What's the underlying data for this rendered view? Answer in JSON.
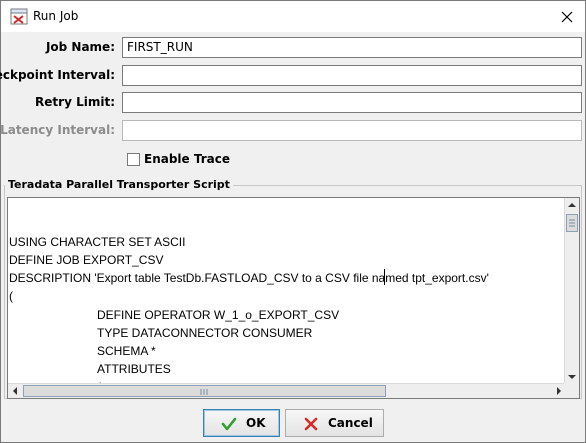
{
  "window": {
    "title": "Run Job",
    "icons": {
      "app": "run-job-icon",
      "close": "close-icon"
    }
  },
  "form": {
    "job_name": {
      "label": "Job Name:",
      "value": "FIRST_RUN"
    },
    "checkpoint_interval": {
      "label": "Checkpoint Interval:",
      "value": ""
    },
    "retry_limit": {
      "label": "Retry Limit:",
      "value": ""
    },
    "latency_interval": {
      "label": "Latency Interval:",
      "value": "",
      "disabled": true
    },
    "enable_trace": {
      "label": "Enable Trace",
      "checked": false
    }
  },
  "script_panel": {
    "title": "Teradata Parallel Transporter Script",
    "lines": [
      "",
      "USING CHARACTER SET ASCII",
      "DEFINE JOB EXPORT_CSV",
      "DESCRIPTION 'Export table TestDb.FASTLOAD_CSV to a CSV file named tpt_export.csv'",
      "(",
      "DEFINE OPERATOR W_1_o_EXPORT_CSV",
      "TYPE DATACONNECTOR CONSUMER",
      "SCHEMA *",
      "ATTRIBUTES",
      "("
    ]
  },
  "buttons": {
    "ok": {
      "label": "OK",
      "icon": "checkmark-icon"
    },
    "cancel": {
      "label": "Cancel",
      "icon": "x-icon"
    }
  },
  "colors": {
    "dialog_bg": "#f0f0f0",
    "ok_check": "#2f9e2f",
    "cancel_x": "#d42a2a",
    "default_button_border": "#3c7fb1"
  }
}
